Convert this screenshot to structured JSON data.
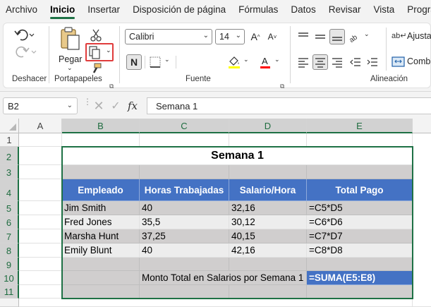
{
  "menu": {
    "tabs": [
      "Archivo",
      "Inicio",
      "Insertar",
      "Disposición de página",
      "Fórmulas",
      "Datos",
      "Revisar",
      "Vista",
      "Progra"
    ]
  },
  "ribbon": {
    "groups": {
      "undo": "Deshacer",
      "clipboard": "Portapapeles",
      "font": "Fuente",
      "alignment": "Alineación"
    },
    "paste_label": "Pegar",
    "font_name": "Calibri",
    "font_size": "14",
    "bold_label": "N",
    "wrap_text_label": "Ajusta",
    "merge_label": "Comb",
    "accent_colors": {
      "highlight": "#ffff00",
      "font_color": "#ff0000",
      "callout": "#e03c3c"
    }
  },
  "formula_bar": {
    "name_box": "B2",
    "fx_label": "fx",
    "formula": "Semana 1"
  },
  "sheet": {
    "columns": [
      "A",
      "B",
      "C",
      "D",
      "E"
    ],
    "rows": [
      "1",
      "2",
      "3",
      "4",
      "5",
      "6",
      "7",
      "8",
      "9",
      "10",
      "11"
    ],
    "title": "Semana 1",
    "headers": [
      "Empleado",
      "Horas Trabajadas",
      "Salario/Hora",
      "Total Pago"
    ],
    "data": [
      [
        "Jim Smith",
        "40",
        "32,16",
        "=C5*D5"
      ],
      [
        "Fred Jones",
        "35,5",
        "30,12",
        "=C6*D6"
      ],
      [
        "Marsha Hunt",
        "37,25",
        "40,15",
        "=C7*D7"
      ],
      [
        "Emily Blunt",
        "40",
        "42,16",
        "=C8*D8"
      ]
    ],
    "total_label": "Monto Total en Salarios por Semana 1",
    "total_formula": "=SUMA(E5:E8)"
  }
}
